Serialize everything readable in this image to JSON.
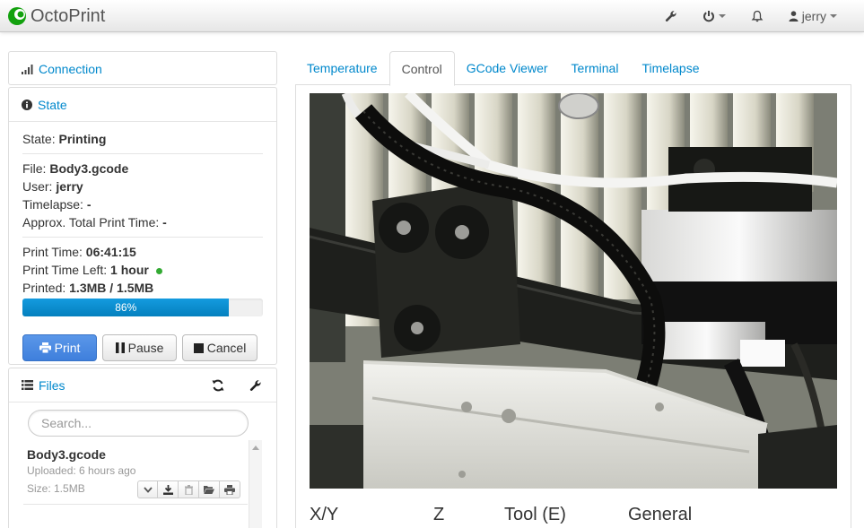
{
  "navbar": {
    "brand": "OctoPrint",
    "user": "jerry",
    "icons": [
      "wrench-icon",
      "power-icon",
      "bell-icon",
      "user-icon"
    ]
  },
  "connection": {
    "title": "Connection"
  },
  "state": {
    "title": "State",
    "state_label": "State:",
    "state_value": "Printing",
    "file_label": "File:",
    "file_value": "Body3.gcode",
    "user_label": "User:",
    "user_value": "jerry",
    "timelapse_label": "Timelapse:",
    "timelapse_value": "-",
    "approx_label": "Approx. Total Print Time:",
    "approx_value": "-",
    "print_time_label": "Print Time:",
    "print_time_value": "06:41:15",
    "time_left_label": "Print Time Left:",
    "time_left_value": "1 hour",
    "printed_label": "Printed:",
    "printed_value": "1.3MB / 1.5MB",
    "progress_percent": 86,
    "progress_text": "86%",
    "print_button": "Print",
    "pause_button": "Pause",
    "cancel_button": "Cancel"
  },
  "files": {
    "title": "Files",
    "search_placeholder": "Search...",
    "items": [
      {
        "name": "Body3.gcode",
        "uploaded": "Uploaded: 6 hours ago",
        "size": "Size: 1.5MB"
      }
    ]
  },
  "tabs": [
    {
      "label": "Temperature",
      "active": false
    },
    {
      "label": "Control",
      "active": true
    },
    {
      "label": "GCode Viewer",
      "active": false
    },
    {
      "label": "Terminal",
      "active": false
    },
    {
      "label": "Timelapse",
      "active": false
    }
  ],
  "control": {
    "headers": [
      "X/Y",
      "Z",
      "Tool (E)",
      "General"
    ]
  },
  "colors": {
    "link": "#0088cc",
    "primary_button": "#4a8ae3",
    "progress": "#0e8fd2",
    "status_dot": "#33aa33"
  }
}
